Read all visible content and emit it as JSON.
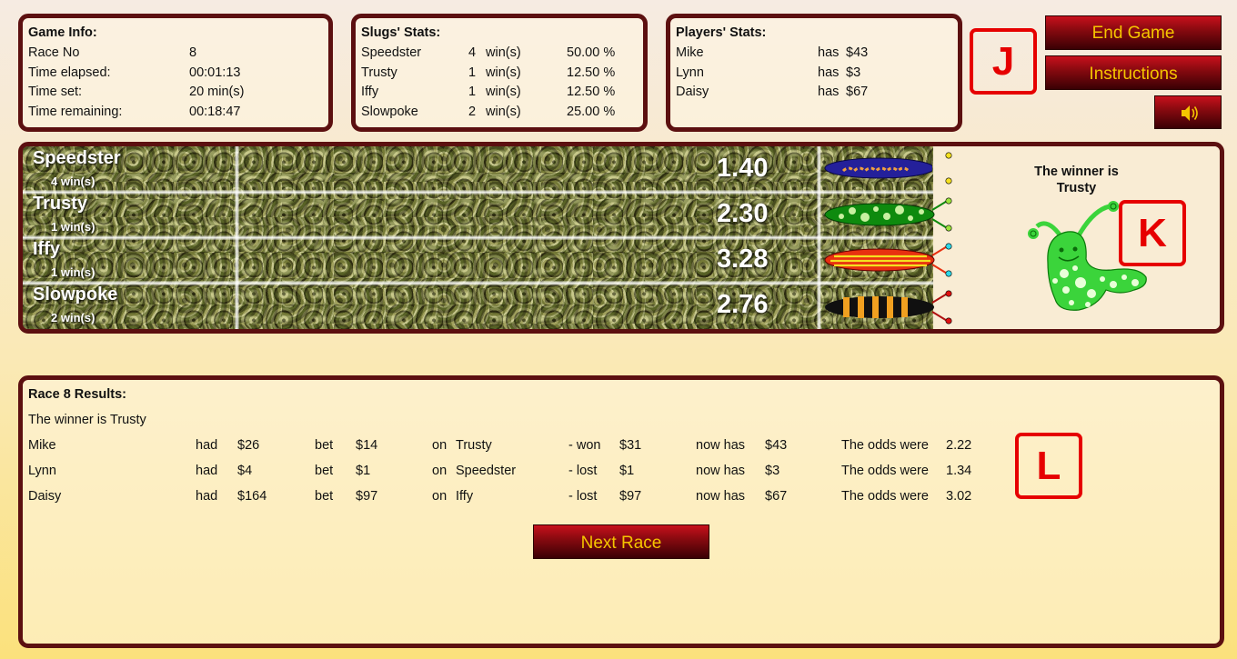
{
  "game_info": {
    "title": "Game Info:",
    "rows": [
      {
        "label": "Race No",
        "value": "8"
      },
      {
        "label": "Time elapsed:",
        "value": "00:01:13"
      },
      {
        "label": "Time set:",
        "value": "20  min(s)"
      },
      {
        "label": "Time remaining:",
        "value": "00:18:47"
      }
    ]
  },
  "slug_stats": {
    "title": "Slugs' Stats:",
    "rows": [
      {
        "name": "Speedster",
        "wins": "4",
        "unit": "win(s)",
        "pct": "50.00 %"
      },
      {
        "name": "Trusty",
        "wins": "1",
        "unit": "win(s)",
        "pct": "12.50 %"
      },
      {
        "name": "Iffy",
        "wins": "1",
        "unit": "win(s)",
        "pct": "12.50 %"
      },
      {
        "name": "Slowpoke",
        "wins": "2",
        "unit": "win(s)",
        "pct": "25.00 %"
      }
    ]
  },
  "player_stats": {
    "title": "Players' Stats:",
    "rows": [
      {
        "name": "Mike",
        "has": "has",
        "amount": "$43"
      },
      {
        "name": "Lynn",
        "has": "has",
        "amount": "$3"
      },
      {
        "name": "Daisy",
        "has": "has",
        "amount": "$67"
      }
    ]
  },
  "buttons": {
    "end_game": "End Game",
    "instructions": "Instructions",
    "sound_icon": "speaker-icon"
  },
  "keys": {
    "j": "J",
    "k": "K",
    "l": "L"
  },
  "track": {
    "lanes": [
      {
        "name": "Speedster",
        "wins": "4  win(s)",
        "odds": "1.40",
        "color": "#24209a",
        "accent": "#f0a040"
      },
      {
        "name": "Trusty",
        "wins": "1  win(s)",
        "odds": "2.30",
        "color": "#0e8a0e",
        "accent": "#c8f0a0"
      },
      {
        "name": "Iffy",
        "wins": "1  win(s)",
        "odds": "3.28",
        "color": "#e83010",
        "accent": "#f5e020"
      },
      {
        "name": "Slowpoke",
        "wins": "2  win(s)",
        "odds": "2.76",
        "color": "#101010",
        "accent": "#f0a020"
      }
    ],
    "winner_line1": "The winner is",
    "winner_line2": "Trusty"
  },
  "results": {
    "title": "Race  8  Results:",
    "winner_line": "The winner is  Trusty",
    "rows": [
      {
        "player": "Mike",
        "had": "had",
        "had_amt": "$26",
        "bet": "bet",
        "bet_amt": "$14",
        "on": "on",
        "slug": "Trusty",
        "outcome": "- won",
        "out_amt": "$31",
        "now": "now has",
        "now_amt": "$43",
        "odds_label": "The odds were",
        "odds": "2.22"
      },
      {
        "player": "Lynn",
        "had": "had",
        "had_amt": "$4",
        "bet": "bet",
        "bet_amt": "$1",
        "on": "on",
        "slug": "Speedster",
        "outcome": "- lost",
        "out_amt": "$1",
        "now": "now has",
        "now_amt": "$3",
        "odds_label": "The odds were",
        "odds": "1.34"
      },
      {
        "player": "Daisy",
        "had": "had",
        "had_amt": "$164",
        "bet": "bet",
        "bet_amt": "$97",
        "on": "on",
        "slug": "Iffy",
        "outcome": "- lost",
        "out_amt": "$97",
        "now": "now has",
        "now_amt": "$67",
        "odds_label": "The odds were",
        "odds": "3.02"
      }
    ],
    "next_race": "Next Race"
  }
}
